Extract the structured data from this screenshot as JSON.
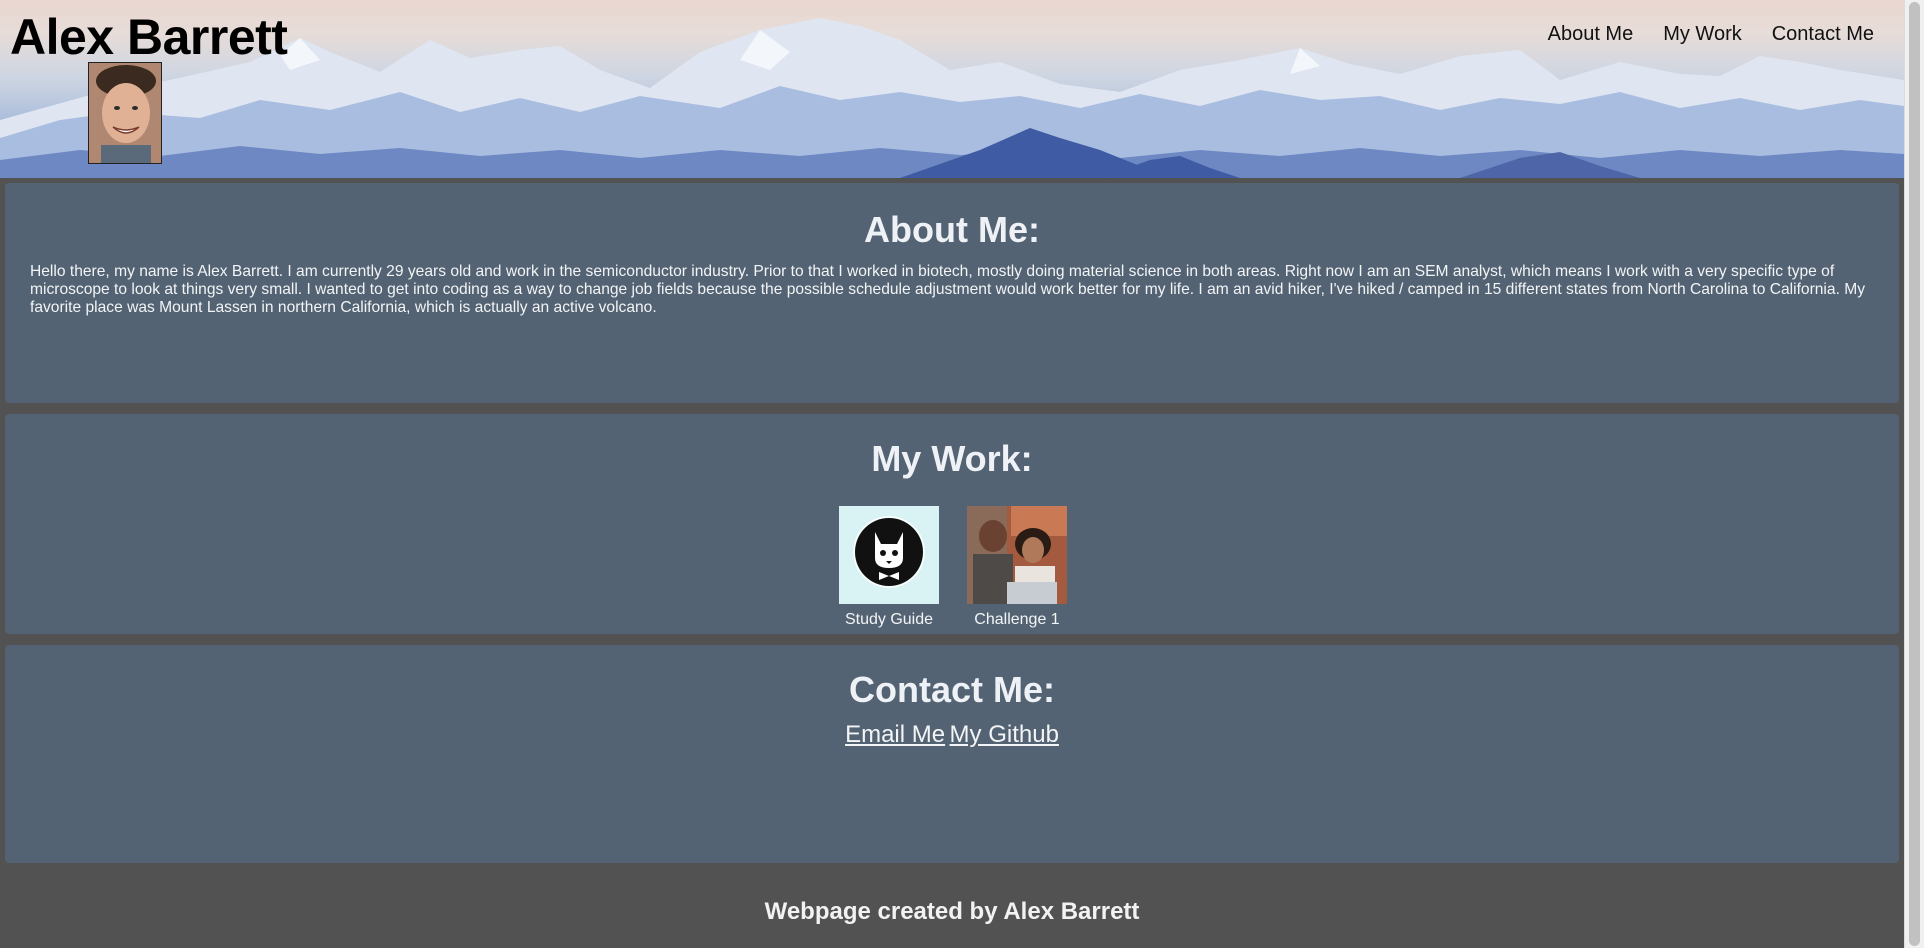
{
  "header": {
    "title": "Alex Barrett",
    "nav": [
      {
        "label": "About Me"
      },
      {
        "label": "My Work"
      },
      {
        "label": "Contact Me"
      }
    ]
  },
  "about": {
    "heading": "About Me:",
    "text": "Hello there, my name is Alex Barrett. I am currently 29 years old and work in the semiconductor industry. Prior to that I worked in biotech, mostly doing material science in both areas. Right now I am an SEM analyst, which means I work with a very specific type of microscope to look at things very small. I wanted to get into coding as a way to change job fields because the possible schedule adjustment would work better for my life. I am an avid hiker, I've hiked / camped in 15 different states from North Carolina to California. My favorite place was Mount Lassen in northern California, which is actually an active volcano."
  },
  "work": {
    "heading": "My Work:",
    "items": [
      {
        "caption": "Study Guide",
        "icon": "cat-logo-icon"
      },
      {
        "caption": "Challenge 1",
        "icon": "photo-two-people"
      }
    ]
  },
  "contact": {
    "heading": "Contact Me:",
    "links": [
      {
        "label": "Email Me"
      },
      {
        "label": "My Github"
      }
    ]
  },
  "footer": {
    "text": "Webpage created by Alex Barrett"
  },
  "colors": {
    "page_bg": "#525252",
    "section_bg": "#546373",
    "heading_text": "#eef2f6"
  }
}
